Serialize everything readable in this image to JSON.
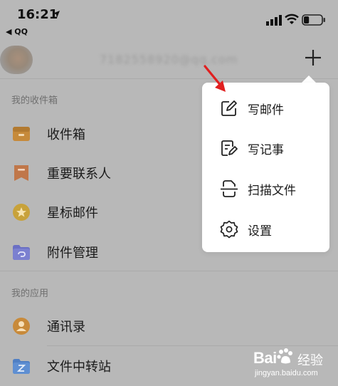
{
  "status_bar": {
    "time": "16:21",
    "back_app": "◀ QQ",
    "battery_level": 0.3
  },
  "header": {
    "email": "7182558920@qq.com"
  },
  "sections": {
    "inbox_title": "我的收件箱",
    "apps_title": "我的应用"
  },
  "mail_items": [
    {
      "label": "收件箱",
      "icon": "inbox-tray-icon",
      "color": "#c68a3a"
    },
    {
      "label": "重要联系人",
      "icon": "bookmark-icon",
      "color": "#c0774a"
    },
    {
      "label": "星标邮件",
      "icon": "star-icon",
      "color": "#c8a23a"
    },
    {
      "label": "附件管理",
      "icon": "attachment-folder-icon",
      "color": "#6a6fc4"
    }
  ],
  "app_items": [
    {
      "label": "通讯录",
      "icon": "contacts-icon",
      "color": "#c88a3a"
    },
    {
      "label": "文件中转站",
      "icon": "file-transfer-icon",
      "color": "#4f7fc4"
    }
  ],
  "menu": {
    "items": [
      {
        "label": "写邮件",
        "icon": "compose-icon"
      },
      {
        "label": "写记事",
        "icon": "note-icon"
      },
      {
        "label": "扫描文件",
        "icon": "scan-document-icon"
      },
      {
        "label": "设置",
        "icon": "gear-icon"
      }
    ]
  },
  "watermark": {
    "brand": "Bai",
    "text": "经验",
    "url": "jingyan.baidu.com"
  },
  "colors": {
    "overlay_bg": "#b8b8b8",
    "menu_bg": "#ffffff",
    "annotation_arrow": "#e02020"
  }
}
